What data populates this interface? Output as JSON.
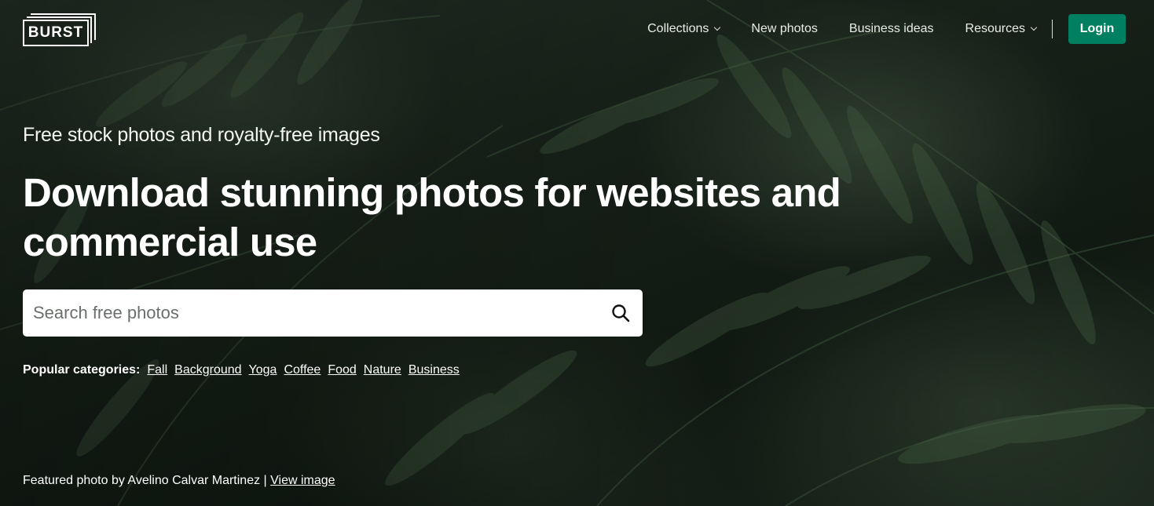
{
  "header": {
    "logo_text": "BURST",
    "nav": [
      {
        "label": "Collections",
        "has_dropdown": true
      },
      {
        "label": "New photos",
        "has_dropdown": false
      },
      {
        "label": "Business ideas",
        "has_dropdown": false
      },
      {
        "label": "Resources",
        "has_dropdown": true
      }
    ],
    "login_label": "Login"
  },
  "hero": {
    "subtitle": "Free stock photos and royalty-free images",
    "headline": "Download stunning photos for websites and commercial use",
    "search": {
      "placeholder": "Search free photos",
      "value": "",
      "icon": "search-icon"
    },
    "popular": {
      "label": "Popular categories:",
      "categories": [
        "Fall",
        "Background",
        "Yoga",
        "Coffee",
        "Food",
        "Nature",
        "Business"
      ]
    },
    "credit": {
      "text": "Featured photo by Avelino Calvar Martinez |",
      "link_label": "View image"
    }
  },
  "colors": {
    "accent": "#008060",
    "background": "#1a251c",
    "text": "#ffffff"
  }
}
